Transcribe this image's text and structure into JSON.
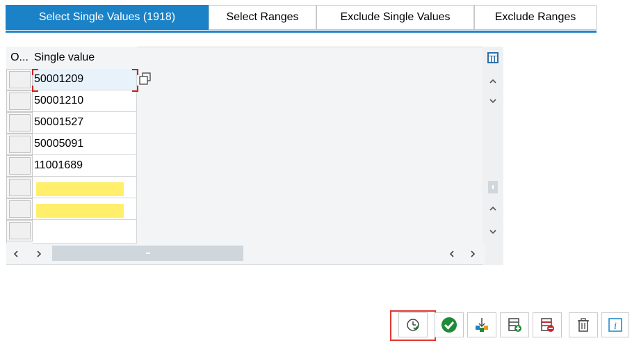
{
  "tabs": [
    {
      "label": "Select Single Values (1918)",
      "active": true
    },
    {
      "label": "Select Ranges",
      "active": false
    },
    {
      "label": "Exclude Single Values",
      "active": false
    },
    {
      "label": "Exclude Ranges",
      "active": false
    }
  ],
  "table": {
    "col_option_header": "O...",
    "col_value_header": "Single value",
    "rows": [
      "50001209",
      "50001210",
      "50001527",
      "50005091",
      "11001689",
      "",
      "",
      ""
    ]
  },
  "icons": {
    "column_settings": "column-settings-icon",
    "scroll_up": "chevron-up-icon",
    "scroll_down": "chevron-down-icon",
    "copy": "copy-icon"
  },
  "toolbar": {
    "buttons": [
      "execute-history-icon",
      "confirm-check-icon",
      "multiple-selection-icon",
      "insert-row-icon",
      "delete-row-icon",
      "trash-icon",
      "info-icon"
    ]
  },
  "colors": {
    "accent": "#1b82c7",
    "required_field": "#ffef6b",
    "highlight": "#e2362f",
    "confirm_green": "#1f8a3a"
  }
}
